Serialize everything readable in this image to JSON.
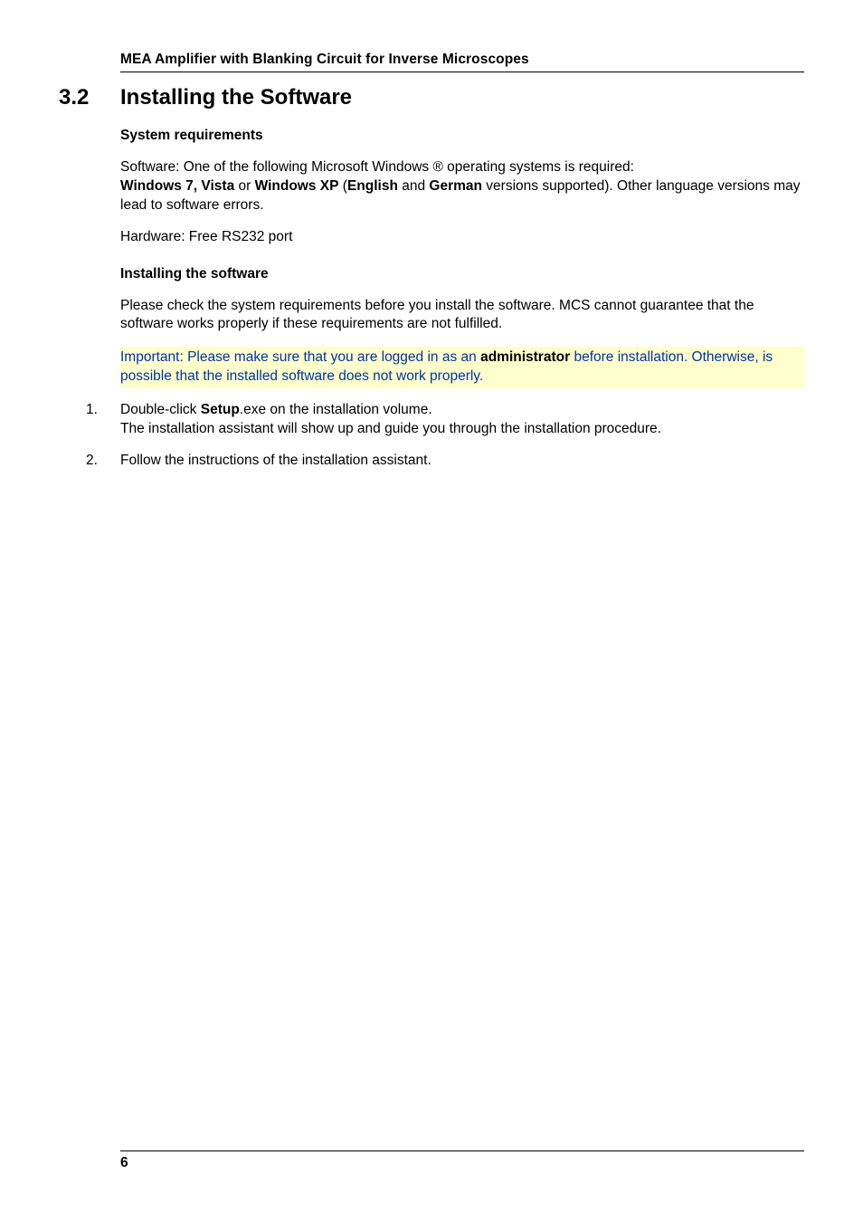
{
  "header": {
    "running_title": "MEA Amplifier with Blanking Circuit for Inverse Microscopes"
  },
  "section": {
    "number": "3.2",
    "title": "Installing the Software"
  },
  "sysreq": {
    "heading": "System requirements",
    "p1_pre": "Software: One of the following Microsoft Windows ® operating systems is required: ",
    "p1_oslist_a": "Windows 7, Vista",
    "p1_or": " or ",
    "p1_oslist_b": "Windows XP",
    "p1_paren_open": " (",
    "p1_lang_a": "English",
    "p1_and": " and ",
    "p1_lang_b": "German",
    "p1_paren_close": " versions supported). Other language versions may lead to software errors.",
    "p2": "Hardware: Free RS232 port"
  },
  "install": {
    "heading": "Installing the software",
    "p1": "Please check the system requirements before you install the software. MCS cannot guarantee that the software works properly if these requirements are not fulfilled.",
    "callout_pre": "Important: Please make sure that you are logged in as an ",
    "callout_admin": "administrator",
    "callout_post": " before installation. Otherwise, is possible that the installed software does not work properly.",
    "steps": [
      {
        "num": "1.",
        "pre": "Double-click ",
        "bold": "Setup",
        "post": ".exe on the installation volume.\nThe installation assistant will show up and guide you through the installation procedure."
      },
      {
        "num": "2.",
        "pre": "Follow the instructions of the installation assistant.",
        "bold": "",
        "post": ""
      }
    ]
  },
  "footer": {
    "page_number": "6"
  }
}
